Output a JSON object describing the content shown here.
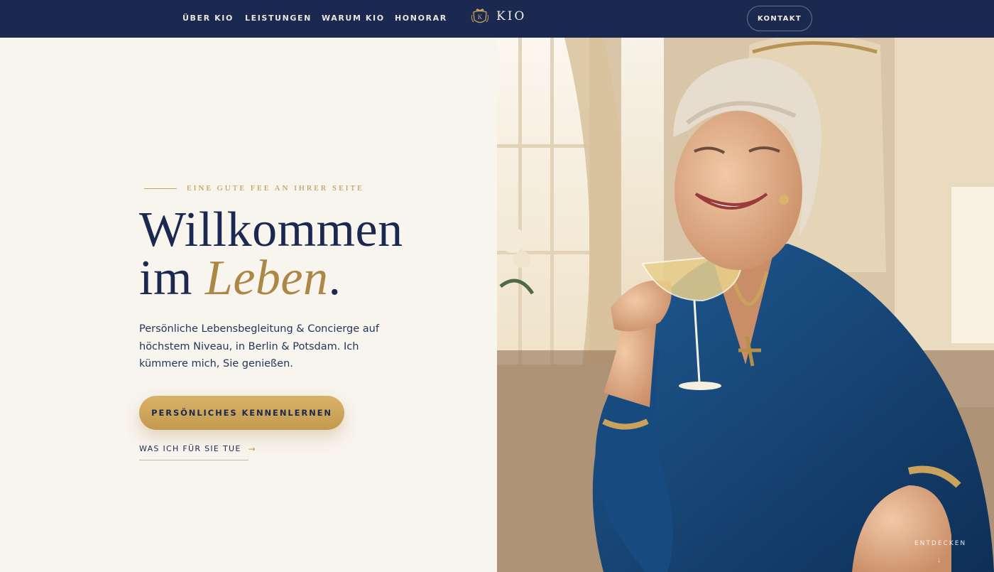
{
  "nav": {
    "links": [
      "ÜBER KIO",
      "LEISTUNGEN",
      "WARUM KIO",
      "HONORAR"
    ],
    "brand": "KIO",
    "contact_label": "KONTAKT"
  },
  "hero": {
    "eyebrow": "EINE GUTE FEE AN IHRER SEITE",
    "headline_line1": "Willkommen",
    "headline_line2_prefix": "im ",
    "headline_accent": "Leben",
    "headline_end": ".",
    "lead": "Persönliche Lebensbegleitung & Concierge auf höchstem Niveau, in Berlin & Potsdam. Ich kümmere mich, Sie genießen.",
    "cta_label": "PERSÖNLICHES KENNENLERNEN",
    "secondary_link": "WAS ICH FÜR SIE TUE",
    "secondary_arrow": "→",
    "photo_alt": "photo-woman-with-champagne",
    "scroll_hint": "ENTDECKEN",
    "scroll_arrow": "↓"
  },
  "colors": {
    "navy": "#1b2850",
    "gold": "#c39a4d",
    "cream": "#f8f4ee"
  }
}
